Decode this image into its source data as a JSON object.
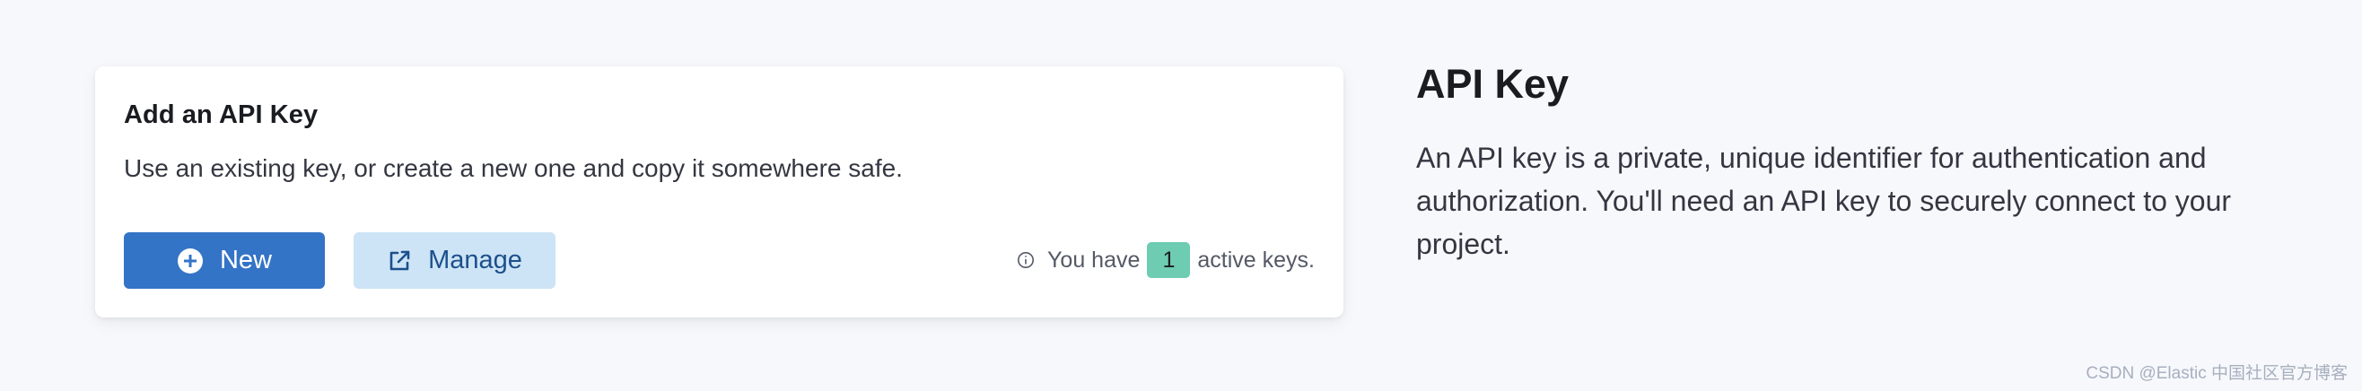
{
  "card": {
    "title": "Add an API Key",
    "description": "Use an existing key, or create a new one and copy it somewhere safe.",
    "new_button": {
      "label": "New",
      "icon": "plus-circle-icon"
    },
    "manage_button": {
      "label": "Manage",
      "icon": "external-link-icon"
    },
    "keys_status": {
      "icon": "info-icon",
      "prefix": "You have",
      "count": "1",
      "suffix": "active keys."
    }
  },
  "side": {
    "title": "API Key",
    "description": "An API key is a private, unique identifier for authentication and authorization. You'll need an API key to securely connect to your project."
  },
  "watermark": "CSDN @Elastic 中国社区官方博客",
  "colors": {
    "page_background": "#f7f8fc",
    "primary_button": "#3474c6",
    "secondary_button": "#cce4f5",
    "badge": "#6dccb1"
  }
}
